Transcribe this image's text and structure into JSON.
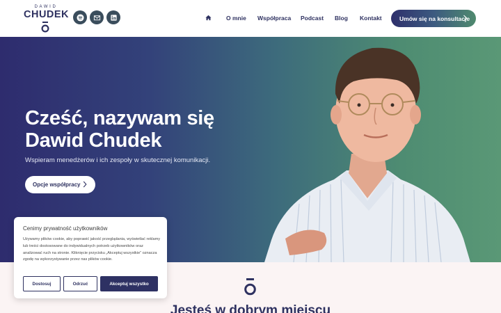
{
  "header": {
    "logo": {
      "top": "DAWID",
      "main": "CHUDEK"
    },
    "social": [
      {
        "icon": "spotify-icon"
      },
      {
        "icon": "mail-icon"
      },
      {
        "icon": "linkedin-icon"
      }
    ],
    "nav": {
      "home_icon": "home-icon",
      "items": [
        "O mnie",
        "Współpraca",
        "Podcast",
        "Blog",
        "Kontakt"
      ]
    },
    "cta_label": "Umów się na konsultacje"
  },
  "hero": {
    "title_line1": "Cześć, nazywam się",
    "title_line2": "Dawid Chudek",
    "subtitle": "Wspieram menedżerów i ich zespoły w skutecznej komunikacji.",
    "button_label": "Opcje współpracy"
  },
  "section": {
    "title": "Jesteś w dobrym miejscu"
  },
  "cookie": {
    "title": "Cenimy prywatność użytkowników",
    "text": "Używamy plików cookie, aby poprawić jakość przeglądania, wyświetlać reklamy lub treści dostosowane do indywidualnych potrzeb użytkowników oraz analizować ruch na stronie. Kliknięcie przycisku „Akceptuj wszystkie” oznacza zgodę na wykorzystywanie przez nas plików cookie.",
    "buttons": {
      "customize": "Dostosuj",
      "reject": "Odrzuć",
      "accept": "Akceptuj wszystko"
    }
  },
  "colors": {
    "navy": "#2e3160",
    "hero_start": "#2e2c6e",
    "hero_end": "#5a9876",
    "social_bg": "#3a4d5c",
    "lower_bg": "#fbf4f4"
  }
}
